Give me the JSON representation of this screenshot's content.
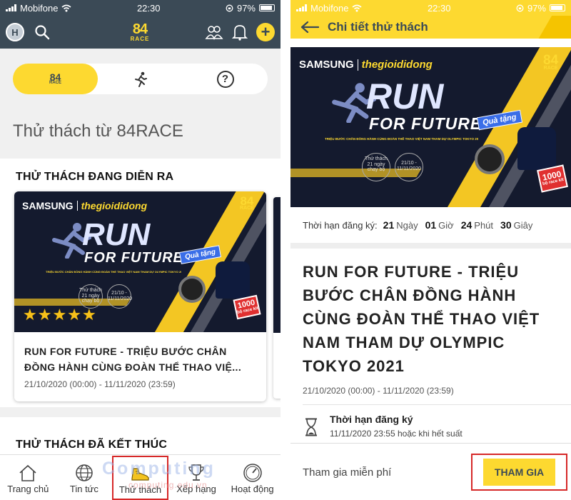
{
  "status_bar": {
    "carrier": "Mobifone",
    "time": "22:30",
    "battery": "97%"
  },
  "left": {
    "header": {
      "avatar_letter": "H",
      "logo_top": "84",
      "logo_bottom": "RACE",
      "plus": "+"
    },
    "segment": {
      "logo_top": "84",
      "logo_bottom": "RACE",
      "help": "?"
    },
    "page_title": "Thử thách từ 84RACE",
    "ongoing_title": "THỬ THÁCH ĐANG DIỄN RA",
    "card": {
      "rating": 5,
      "name_line1": "RUN FOR FUTURE - TRIỆU BƯỚC CHÂN",
      "name_line2": "ĐỒNG HÀNH CÙNG ĐOÀN THỂ THAO VIỆ...",
      "dates": "21/10/2020 (00:00) - 11/11/2020 (23:59)"
    },
    "ended_title": "THỬ THÁCH ĐÃ KẾT THÚC",
    "tabs": [
      {
        "label": "Trang chủ",
        "icon": "home-icon"
      },
      {
        "label": "Tin tức",
        "icon": "globe-icon"
      },
      {
        "label": "Thử thách",
        "icon": "shoe-icon",
        "active": true
      },
      {
        "label": "Xếp hạng",
        "icon": "trophy-icon"
      },
      {
        "label": "Hoạt động",
        "icon": "speedometer-icon"
      }
    ]
  },
  "banner": {
    "brand": "SAMSUNG",
    "store": "thegioididong",
    "run": "RUN",
    "future": "FOR FUTURE",
    "gift": "Quà tặng",
    "subtitle": "TRIỆU BƯỚC CHÂN ĐỒNG HÀNH CÙNG ĐOÀN THỂ THAO VIỆT NAM THAM DỰ OLYMPIC TOKYO 2021",
    "badge_number": "1000",
    "badge_text": "bộ race kit",
    "info1": "Thử thách 21 ngày chạy bộ",
    "info2": "21/10 - 11/11/2020",
    "logo_top": "84",
    "logo_bottom": "RACE"
  },
  "right": {
    "header_title": "Chi tiết thử thách",
    "deadline_label": "Thời hạn đăng ký:",
    "countdown": [
      {
        "value": "21",
        "unit": "Ngày"
      },
      {
        "value": "01",
        "unit": "Giờ"
      },
      {
        "value": "24",
        "unit": "Phút"
      },
      {
        "value": "30",
        "unit": "Giây"
      }
    ],
    "title_lines": [
      "RUN FOR FUTURE - TRIỆU",
      "BƯỚC CHÂN ĐỒNG HÀNH",
      "CÙNG ĐOÀN THỂ THAO VIỆT",
      "NAM THAM DỰ OLYMPIC",
      "TOKYO 2021"
    ],
    "dates": "21/10/2020 (00:00) - 11/11/2020 (23:59)",
    "reg_label": "Thời hạn đăng ký",
    "reg_value": "11/11/2020 23:55 hoặc khi hết suất",
    "join_fee": "Tham gia miễn phí",
    "join_button": "THAM GIA"
  },
  "watermark": {
    "main": "Computing",
    "sub": "computing.edu.vn"
  },
  "colors": {
    "brand_yellow": "#fdd930",
    "header_dark": "#3b4a56",
    "highlight_red": "#d62828",
    "banner_navy": "#141a2e"
  }
}
